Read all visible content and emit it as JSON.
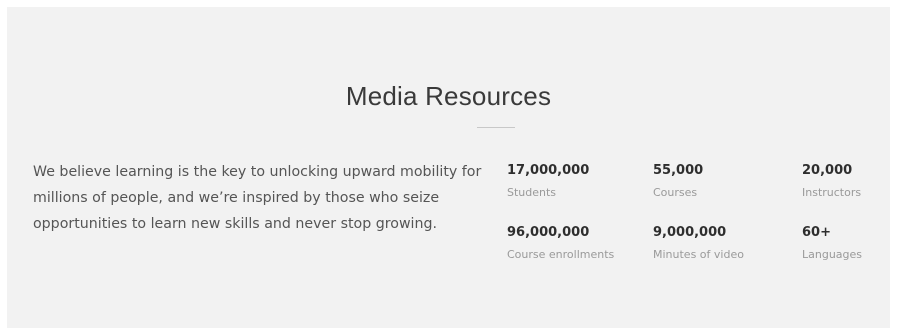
{
  "section": {
    "title": "Media Resources",
    "intro": "We believe learning is the key to unlocking upward mobility for millions of people, and we’re inspired by those who seize opportunities to learn new skills and never stop growing."
  },
  "stats": [
    {
      "value": "17,000,000",
      "label": "Students"
    },
    {
      "value": "55,000",
      "label": "Courses"
    },
    {
      "value": "20,000",
      "label": "Instructors"
    },
    {
      "value": "96,000,000",
      "label": "Course enrollments"
    },
    {
      "value": "9,000,000",
      "label": "Minutes of video"
    },
    {
      "value": "60+",
      "label": "Languages"
    }
  ],
  "colors": {
    "background": "#f2f2f2",
    "title": "#3a3a3a",
    "body_text": "#555555",
    "stat_value": "#2e2e2e",
    "stat_label": "#9a9a9a",
    "divider": "#c8c8c8"
  }
}
